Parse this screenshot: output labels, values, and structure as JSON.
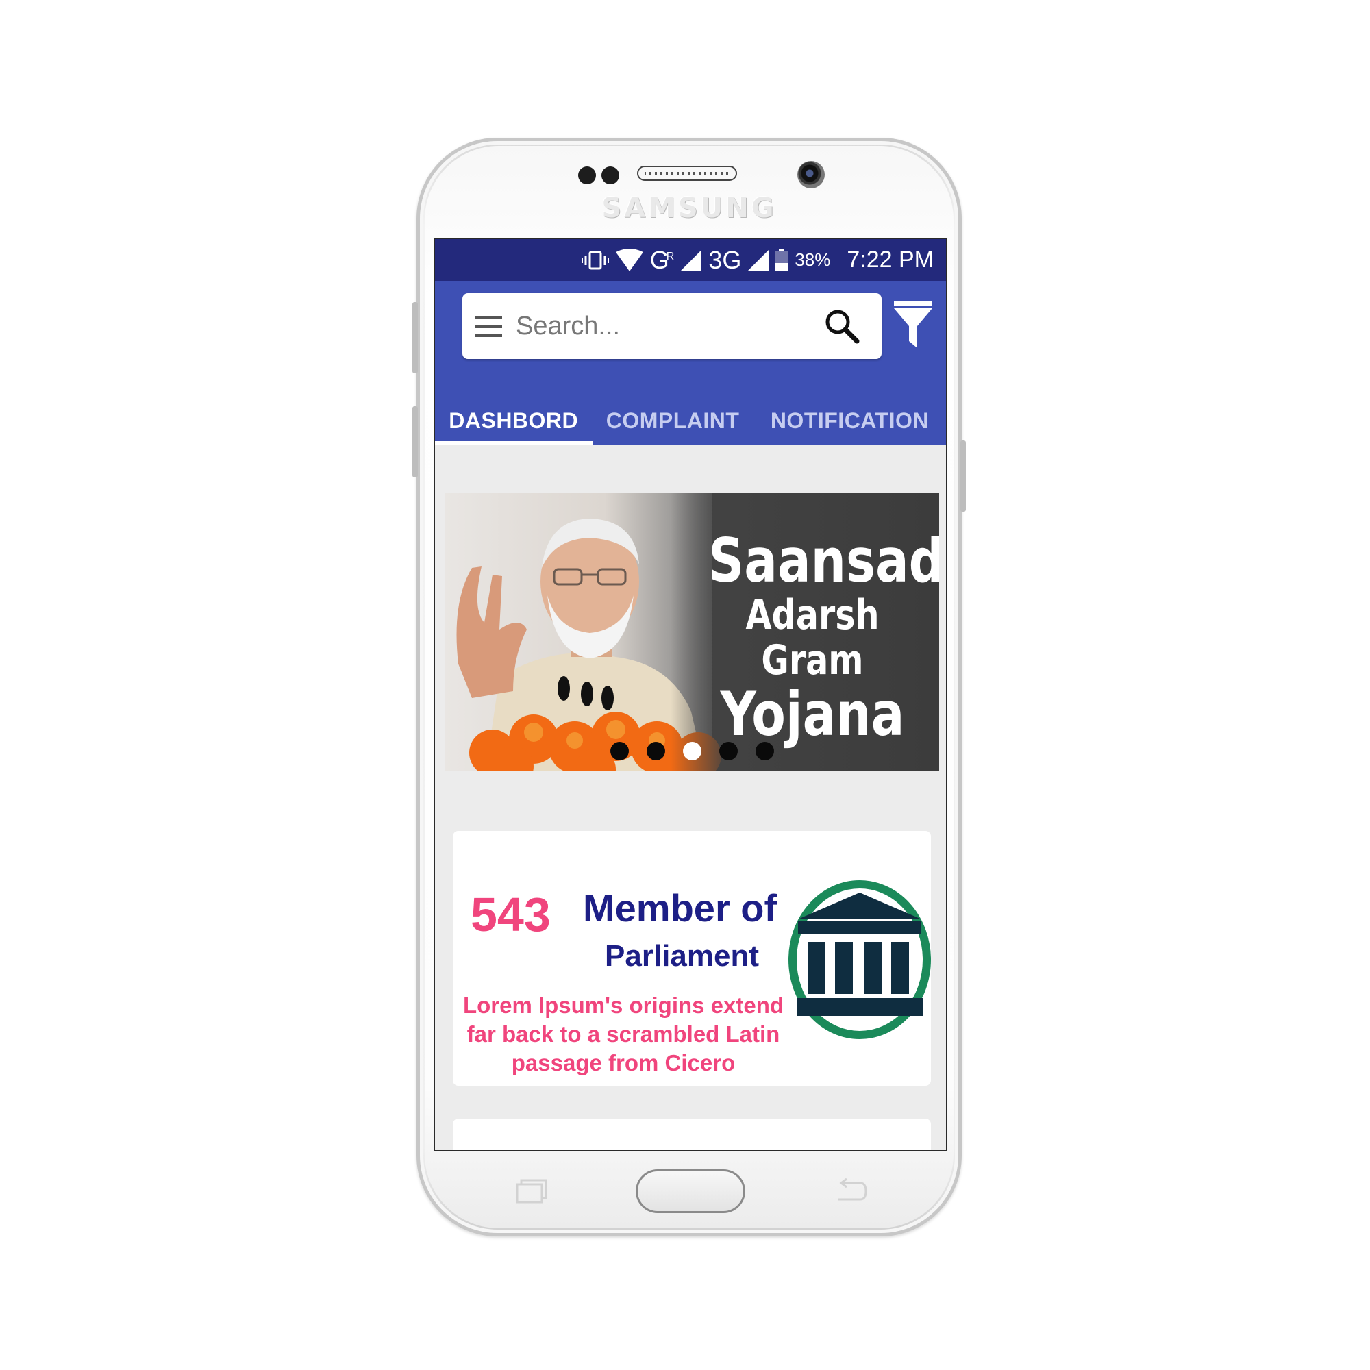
{
  "device": {
    "brand": "SAMSUNG"
  },
  "status_bar": {
    "network_1": "G",
    "network_1_sup": "R",
    "network_2": "3G",
    "battery": "38%",
    "time": "7:22 PM"
  },
  "search": {
    "placeholder": "Search..."
  },
  "tabs": [
    {
      "label": "DASHBORD",
      "active": true
    },
    {
      "label": "COMPLAINT",
      "active": false
    },
    {
      "label": "NOTIFICATION",
      "active": false
    }
  ],
  "banner": {
    "line1": "Saansad",
    "line2": "Adarsh Gram",
    "line3": "Yojana",
    "slides": 5,
    "active_slide": 3
  },
  "card": {
    "count": "543",
    "title_line1": "Member of",
    "title_line2": "Parliament",
    "description": "Lorem Ipsum's origins extend far back to a scrambled Latin passage from Cicero"
  },
  "colors": {
    "status_bar": "#23297c",
    "app_bar": "#3e50b4",
    "accent_pink": "#f0457d",
    "title_navy": "#1d1f86",
    "icon_green": "#1b8a5a",
    "icon_navy": "#0f2d40"
  },
  "icons": {
    "vibrate": "vibrate-icon",
    "wifi": "wifi-icon",
    "signal": "signal-icon",
    "battery": "battery-icon",
    "menu": "hamburger-menu-icon",
    "search": "magnifier-icon",
    "filter": "funnel-filter-icon",
    "parliament": "parliament-building-icon"
  }
}
